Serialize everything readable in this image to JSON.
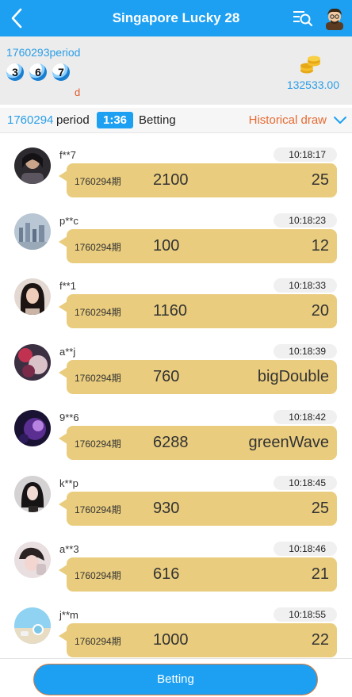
{
  "header": {
    "title": "Singapore Lucky 28",
    "back_icon": "back-arrow-icon",
    "list_search_icon": "list-search-icon",
    "avatar_icon": "user-avatar-icon"
  },
  "last_draw": {
    "period": "1760293period",
    "balls": [
      "3",
      "6",
      "7"
    ],
    "result": "d",
    "balance": "132533.00",
    "coins_icon": "coins-icon"
  },
  "current": {
    "period_number": "1760294",
    "period_word": "period",
    "countdown": "1:36",
    "status": "Betting",
    "historical_label": "Historical draw"
  },
  "bets": [
    {
      "user": "f**7",
      "time": "10:18:17",
      "period": "1760294期",
      "amount": "2100",
      "pick": "25"
    },
    {
      "user": "p**c",
      "time": "10:18:23",
      "period": "1760294期",
      "amount": "100",
      "pick": "12"
    },
    {
      "user": "f**1",
      "time": "10:18:33",
      "period": "1760294期",
      "amount": "1160",
      "pick": "20"
    },
    {
      "user": "a**j",
      "time": "10:18:39",
      "period": "1760294期",
      "amount": "760",
      "pick": "bigDouble"
    },
    {
      "user": "9**6",
      "time": "10:18:42",
      "period": "1760294期",
      "amount": "6288",
      "pick": "greenWave"
    },
    {
      "user": "k**p",
      "time": "10:18:45",
      "period": "1760294期",
      "amount": "930",
      "pick": "25"
    },
    {
      "user": "a**3",
      "time": "10:18:46",
      "period": "1760294期",
      "amount": "616",
      "pick": "21"
    },
    {
      "user": "j**m",
      "time": "10:18:55",
      "period": "1760294期",
      "amount": "1000",
      "pick": "22"
    }
  ],
  "footer": {
    "betting_label": "Betting"
  },
  "colors": {
    "primary": "#1da0f2",
    "bubble": "#e9cc7d",
    "accent_orange": "#e86a32"
  }
}
